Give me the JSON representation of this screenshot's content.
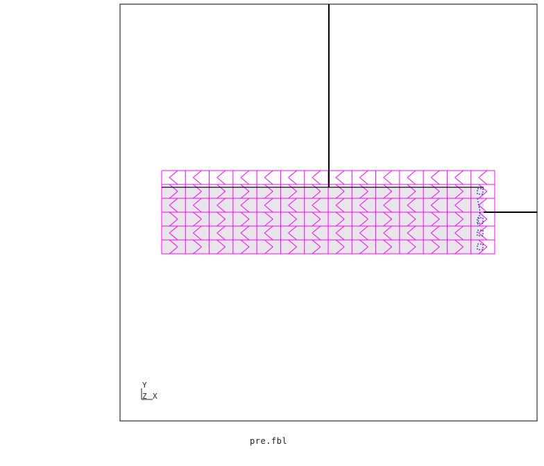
{
  "viewport": {
    "background": "#ffffff",
    "frame_color": "#000000"
  },
  "mesh": {
    "columns": 14,
    "row_bands": 6,
    "line_color": "#ff00ff",
    "fill_color": "#e8e6ea",
    "marker_color": "#0000cc"
  },
  "triad": {
    "y_label": "Y",
    "z_label": "Z",
    "x_label": "X"
  },
  "footer": {
    "filename": "pre.fbl"
  }
}
